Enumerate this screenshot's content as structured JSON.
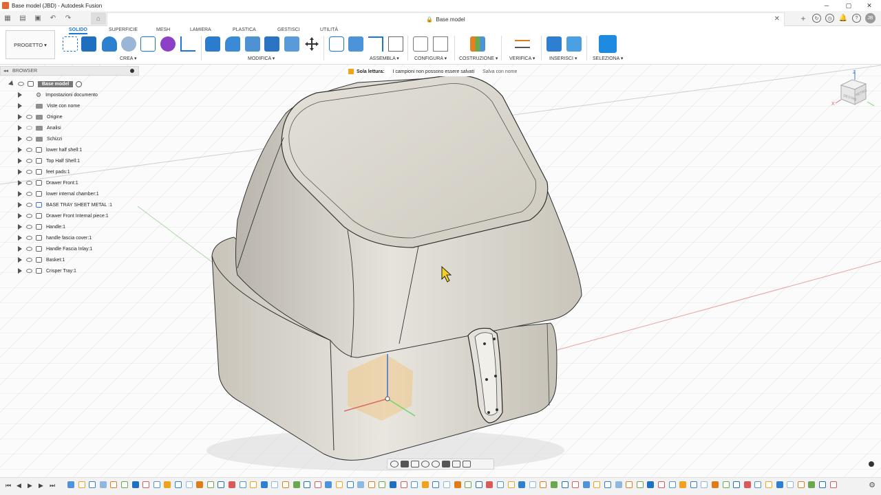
{
  "window": {
    "title": "Base model (JBD) - Autodesk Fusion"
  },
  "tabs": {
    "document_title": "Base model",
    "user_initials": "JB"
  },
  "ribbon": {
    "project_label": "PROGETTO",
    "tabs": [
      "SOLIDO",
      "SUPERFICIE",
      "MESH",
      "LAMIERA",
      "PLASTICA",
      "GESTISCI",
      "UTILITÀ"
    ],
    "active_tab": "SOLIDO",
    "groups": [
      "CREA",
      "MODIFICA",
      "ASSEMBLA",
      "CONFIGURA",
      "COSTRUZIONE",
      "VERIFICA",
      "INSERISCI",
      "SELEZIONA"
    ]
  },
  "browser": {
    "title": "BROWSER",
    "root": "Base model",
    "items": [
      {
        "label": "Impostazioni documento",
        "icon": "gear-icon"
      },
      {
        "label": "Viste con nome",
        "icon": "folder-icon"
      },
      {
        "label": "Origine",
        "icon": "folder-icon"
      },
      {
        "label": "Analisi",
        "icon": "folder-icon"
      },
      {
        "label": "Schizzi",
        "icon": "folder-icon"
      },
      {
        "label": "lower half shell:1",
        "icon": "component-icon"
      },
      {
        "label": "Top Half Shell:1",
        "icon": "component-icon"
      },
      {
        "label": "feet pads:1",
        "icon": "component-icon"
      },
      {
        "label": "Drawer Front:1",
        "icon": "component-icon"
      },
      {
        "label": "lower internal chamber:1",
        "icon": "component-icon"
      },
      {
        "label": "BASE TRAY SHEET METAL :1",
        "icon": "sheet-metal-icon"
      },
      {
        "label": "Drawer Front Internal piece:1",
        "icon": "component-icon"
      },
      {
        "label": "Handle:1",
        "icon": "component-icon"
      },
      {
        "label": "handle fascia cover:1",
        "icon": "component-icon"
      },
      {
        "label": "Handle Fascia Inlay:1",
        "icon": "component-icon"
      },
      {
        "label": "Basket:1",
        "icon": "component-icon"
      },
      {
        "label": "Crisper Tray:1",
        "icon": "component-icon"
      }
    ]
  },
  "notice": {
    "title": "Sola lettura:",
    "message": "I campioni non possono essere salvati",
    "action": "Salva con nome"
  },
  "viewcube": {
    "face_front": "DESTRA",
    "face_right": "RETRO",
    "axis_z": "Z",
    "axis_x": "X"
  },
  "colors": {
    "accent": "#1a76d2",
    "model": "#d4d0c6",
    "grid": "#d6d6d6",
    "warning": "#f0a21c"
  }
}
